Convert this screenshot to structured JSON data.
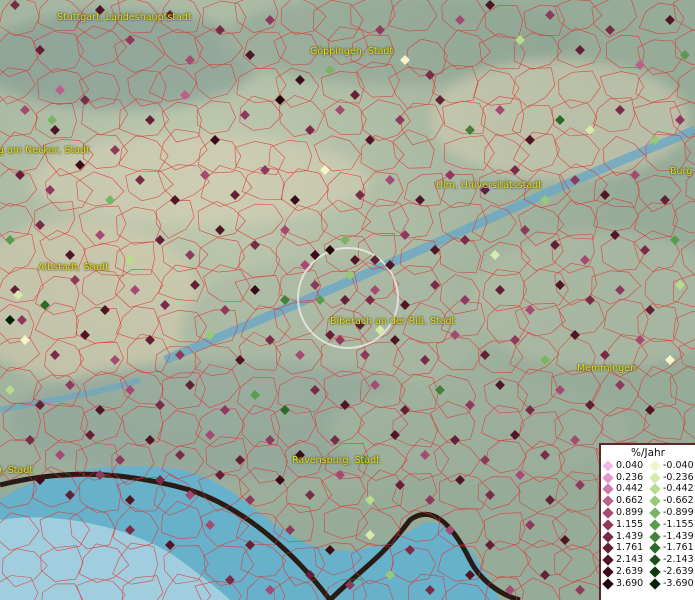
{
  "cities": [
    {
      "name": "Stuttgart, Landeshauptstadt",
      "pos": [
        57,
        12
      ]
    },
    {
      "name": "Göppingen, Stadt",
      "pos": [
        310,
        46
      ]
    },
    {
      "name": "g am Neckar, Stadt",
      "pos": [
        -2,
        145
      ]
    },
    {
      "name": "Ulm, Universitätsstadt",
      "pos": [
        436,
        180
      ]
    },
    {
      "name": "Burg",
      "pos": [
        670,
        166
      ]
    },
    {
      "name": "Albstadt, Stadt",
      "pos": [
        38,
        262
      ]
    },
    {
      "name": "Biberach an der Riß, Stadt",
      "pos": [
        330,
        316
      ]
    },
    {
      "name": "Memmingen",
      "pos": [
        577,
        363
      ]
    },
    {
      "name": "Ravensburg, Stadt",
      "pos": [
        292,
        455
      ]
    },
    {
      "name": "), Stadt",
      "pos": [
        -2,
        465
      ]
    }
  ],
  "legend": {
    "title": "%/Jahr",
    "positive": [
      {
        "label": "0.040",
        "color": "#f4b8e4"
      },
      {
        "label": "0.236",
        "color": "#e497c8"
      },
      {
        "label": "0.442",
        "color": "#d07aa8"
      },
      {
        "label": "0.662",
        "color": "#bb5f8c"
      },
      {
        "label": "0.899",
        "color": "#a54a72"
      },
      {
        "label": "1.155",
        "color": "#8e3a5c"
      },
      {
        "label": "1.439",
        "color": "#782c48"
      },
      {
        "label": "1.761",
        "color": "#632036"
      },
      {
        "label": "2.143",
        "color": "#4f1626"
      },
      {
        "label": "2.639",
        "color": "#3a0d18"
      },
      {
        "label": "3.690",
        "color": "#25060c"
      }
    ],
    "negative": [
      {
        "label": "-0.040",
        "color": "#f2f5c8"
      },
      {
        "label": "-0.236",
        "color": "#d6ebaa"
      },
      {
        "label": "-0.442",
        "color": "#b8dc8e"
      },
      {
        "label": "-0.662",
        "color": "#98c978"
      },
      {
        "label": "-0.899",
        "color": "#78b462"
      },
      {
        "label": "-1.155",
        "color": "#5a9c4c"
      },
      {
        "label": "-1.439",
        "color": "#408338"
      },
      {
        "label": "-1.761",
        "color": "#2b6a28"
      },
      {
        "label": "-2.143",
        "color": "#1b521b"
      },
      {
        "label": "-2.639",
        "color": "#0e3b10"
      },
      {
        "label": "-3.690",
        "color": "#052407"
      }
    ]
  },
  "points": [
    [
      15,
      5,
      7
    ],
    [
      40,
      50,
      8
    ],
    [
      60,
      90,
      4
    ],
    [
      100,
      10,
      9
    ],
    [
      130,
      40,
      6
    ],
    [
      170,
      15,
      8
    ],
    [
      190,
      60,
      5
    ],
    [
      220,
      30,
      7
    ],
    [
      250,
      55,
      9
    ],
    [
      270,
      20,
      6
    ],
    [
      300,
      80,
      10
    ],
    [
      330,
      70,
      -5
    ],
    [
      355,
      95,
      8
    ],
    [
      380,
      30,
      6
    ],
    [
      405,
      60,
      -1
    ],
    [
      430,
      75,
      7
    ],
    [
      460,
      20,
      5
    ],
    [
      490,
      5,
      9
    ],
    [
      520,
      40,
      -3
    ],
    [
      550,
      15,
      6
    ],
    [
      580,
      50,
      8
    ],
    [
      610,
      30,
      7
    ],
    [
      640,
      65,
      4
    ],
    [
      670,
      20,
      9
    ],
    [
      685,
      55,
      -6
    ],
    [
      25,
      110,
      5
    ],
    [
      55,
      130,
      9
    ],
    [
      85,
      100,
      7
    ],
    [
      115,
      150,
      6
    ],
    [
      150,
      120,
      8
    ],
    [
      185,
      95,
      4
    ],
    [
      215,
      140,
      10
    ],
    [
      245,
      115,
      6
    ],
    [
      280,
      100,
      11
    ],
    [
      310,
      130,
      7
    ],
    [
      340,
      110,
      5
    ],
    [
      370,
      140,
      9
    ],
    [
      400,
      120,
      6
    ],
    [
      440,
      100,
      8
    ],
    [
      470,
      130,
      -7
    ],
    [
      500,
      110,
      5
    ],
    [
      530,
      140,
      9
    ],
    [
      560,
      120,
      -8
    ],
    [
      590,
      130,
      -2
    ],
    [
      620,
      110,
      7
    ],
    [
      655,
      140,
      -4
    ],
    [
      680,
      120,
      6
    ],
    [
      20,
      175,
      8
    ],
    [
      50,
      190,
      6
    ],
    [
      80,
      165,
      10
    ],
    [
      110,
      200,
      -5
    ],
    [
      140,
      180,
      7
    ],
    [
      175,
      200,
      9
    ],
    [
      205,
      175,
      5
    ],
    [
      235,
      195,
      8
    ],
    [
      265,
      170,
      6
    ],
    [
      295,
      200,
      10
    ],
    [
      325,
      170,
      -1
    ],
    [
      360,
      195,
      7
    ],
    [
      390,
      180,
      5
    ],
    [
      420,
      200,
      9
    ],
    [
      450,
      175,
      6
    ],
    [
      485,
      190,
      8
    ],
    [
      515,
      170,
      7
    ],
    [
      545,
      200,
      -4
    ],
    [
      575,
      180,
      6
    ],
    [
      605,
      195,
      9
    ],
    [
      635,
      175,
      5
    ],
    [
      665,
      200,
      8
    ],
    [
      10,
      240,
      -6
    ],
    [
      40,
      225,
      7
    ],
    [
      70,
      255,
      9
    ],
    [
      100,
      235,
      5
    ],
    [
      130,
      260,
      -3
    ],
    [
      160,
      240,
      8
    ],
    [
      190,
      255,
      6
    ],
    [
      220,
      230,
      9
    ],
    [
      255,
      245,
      7
    ],
    [
      285,
      230,
      5
    ],
    [
      315,
      255,
      10
    ],
    [
      345,
      240,
      -5
    ],
    [
      375,
      260,
      8
    ],
    [
      405,
      235,
      6
    ],
    [
      435,
      250,
      9
    ],
    [
      465,
      240,
      7
    ],
    [
      495,
      255,
      -2
    ],
    [
      525,
      230,
      6
    ],
    [
      555,
      245,
      8
    ],
    [
      585,
      260,
      5
    ],
    [
      615,
      235,
      9
    ],
    [
      645,
      250,
      7
    ],
    [
      675,
      240,
      -6
    ],
    [
      15,
      290,
      8
    ],
    [
      45,
      305,
      -8
    ],
    [
      75,
      280,
      6
    ],
    [
      105,
      310,
      9
    ],
    [
      135,
      290,
      5
    ],
    [
      165,
      305,
      7
    ],
    [
      195,
      285,
      8
    ],
    [
      225,
      310,
      6
    ],
    [
      255,
      290,
      10
    ],
    [
      285,
      300,
      -7
    ],
    [
      315,
      285,
      6
    ],
    [
      345,
      300,
      8
    ],
    [
      375,
      290,
      5
    ],
    [
      405,
      305,
      9
    ],
    [
      435,
      285,
      7
    ],
    [
      465,
      300,
      6
    ],
    [
      500,
      290,
      8
    ],
    [
      530,
      310,
      5
    ],
    [
      560,
      285,
      9
    ],
    [
      590,
      300,
      7
    ],
    [
      620,
      290,
      6
    ],
    [
      650,
      310,
      8
    ],
    [
      680,
      285,
      -3
    ],
    [
      25,
      340,
      -1
    ],
    [
      55,
      355,
      7
    ],
    [
      85,
      335,
      9
    ],
    [
      115,
      360,
      5
    ],
    [
      150,
      340,
      8
    ],
    [
      180,
      355,
      6
    ],
    [
      210,
      335,
      -4
    ],
    [
      240,
      360,
      9
    ],
    [
      270,
      340,
      7
    ],
    [
      300,
      355,
      5
    ],
    [
      330,
      335,
      8
    ],
    [
      365,
      355,
      6
    ],
    [
      395,
      340,
      9
    ],
    [
      425,
      360,
      7
    ],
    [
      455,
      335,
      5
    ],
    [
      485,
      355,
      8
    ],
    [
      515,
      340,
      6
    ],
    [
      545,
      360,
      -5
    ],
    [
      575,
      335,
      9
    ],
    [
      605,
      355,
      7
    ],
    [
      640,
      340,
      5
    ],
    [
      670,
      360,
      -1
    ],
    [
      10,
      390,
      -3
    ],
    [
      40,
      405,
      8
    ],
    [
      70,
      385,
      6
    ],
    [
      100,
      410,
      9
    ],
    [
      130,
      390,
      5
    ],
    [
      160,
      405,
      7
    ],
    [
      190,
      385,
      8
    ],
    [
      225,
      410,
      6
    ],
    [
      255,
      395,
      -6
    ],
    [
      285,
      410,
      -8
    ],
    [
      315,
      390,
      7
    ],
    [
      345,
      405,
      9
    ],
    [
      375,
      385,
      5
    ],
    [
      405,
      410,
      8
    ],
    [
      440,
      390,
      -7
    ],
    [
      470,
      405,
      6
    ],
    [
      500,
      385,
      9
    ],
    [
      530,
      410,
      7
    ],
    [
      560,
      390,
      5
    ],
    [
      590,
      405,
      8
    ],
    [
      620,
      385,
      6
    ],
    [
      650,
      410,
      9
    ],
    [
      30,
      440,
      7
    ],
    [
      60,
      455,
      5
    ],
    [
      90,
      435,
      8
    ],
    [
      120,
      460,
      6
    ],
    [
      150,
      440,
      9
    ],
    [
      180,
      455,
      7
    ],
    [
      210,
      435,
      5
    ],
    [
      240,
      460,
      8
    ],
    [
      270,
      440,
      6
    ],
    [
      300,
      455,
      10
    ],
    [
      335,
      440,
      7
    ],
    [
      365,
      460,
      -6
    ],
    [
      395,
      435,
      9
    ],
    [
      425,
      455,
      5
    ],
    [
      455,
      440,
      8
    ],
    [
      485,
      460,
      6
    ],
    [
      515,
      435,
      9
    ],
    [
      545,
      455,
      7
    ],
    [
      575,
      440,
      5
    ],
    [
      40,
      480,
      10
    ],
    [
      70,
      495,
      8
    ],
    [
      100,
      475,
      6
    ],
    [
      130,
      500,
      9
    ],
    [
      160,
      480,
      7
    ],
    [
      190,
      495,
      5
    ],
    [
      220,
      475,
      8
    ],
    [
      250,
      500,
      6
    ],
    [
      280,
      480,
      10
    ],
    [
      310,
      495,
      7
    ],
    [
      340,
      475,
      5
    ],
    [
      370,
      500,
      -3
    ],
    [
      400,
      485,
      8
    ],
    [
      430,
      500,
      6
    ],
    [
      460,
      480,
      9
    ],
    [
      490,
      495,
      7
    ],
    [
      520,
      475,
      5
    ],
    [
      550,
      500,
      8
    ],
    [
      580,
      485,
      6
    ],
    [
      130,
      530,
      7
    ],
    [
      170,
      545,
      9
    ],
    [
      210,
      525,
      5
    ],
    [
      250,
      545,
      8
    ],
    [
      290,
      530,
      6
    ],
    [
      330,
      550,
      10
    ],
    [
      370,
      535,
      -2
    ],
    [
      410,
      550,
      7
    ],
    [
      450,
      530,
      5
    ],
    [
      490,
      545,
      8
    ],
    [
      530,
      525,
      6
    ],
    [
      565,
      540,
      9
    ],
    [
      230,
      580,
      7
    ],
    [
      270,
      590,
      5
    ],
    [
      310,
      575,
      8
    ],
    [
      350,
      585,
      6
    ],
    [
      390,
      575,
      -4
    ],
    [
      430,
      590,
      7
    ],
    [
      470,
      575,
      9
    ],
    [
      510,
      590,
      5
    ],
    [
      545,
      575,
      8
    ],
    [
      580,
      590,
      6
    ],
    [
      330,
      250,
      11
    ],
    [
      350,
      275,
      -4
    ],
    [
      370,
      300,
      7
    ],
    [
      320,
      300,
      -6
    ],
    [
      390,
      265,
      9
    ],
    [
      360,
      325,
      8
    ],
    [
      340,
      340,
      6
    ],
    [
      305,
      265,
      5
    ],
    [
      380,
      330,
      -2
    ],
    [
      355,
      260,
      9
    ],
    [
      52,
      120,
      -5
    ],
    [
      18,
      295,
      -2
    ],
    [
      22,
      320,
      6
    ],
    [
      10,
      320,
      -11
    ]
  ]
}
